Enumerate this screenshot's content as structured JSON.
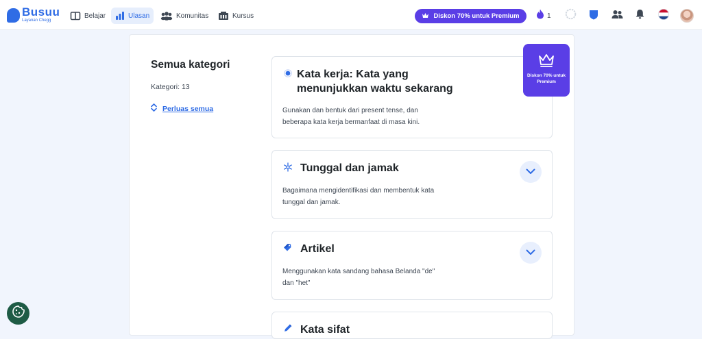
{
  "brand": {
    "name": "Busuu",
    "tagline": "Layanan Chegg"
  },
  "nav": [
    {
      "label": "Belajar",
      "icon": "book-icon",
      "active": false
    },
    {
      "label": "Ulasan",
      "icon": "bar-chart-icon",
      "active": true
    },
    {
      "label": "Komunitas",
      "icon": "community-icon",
      "active": false
    },
    {
      "label": "Kursus",
      "icon": "courses-icon",
      "active": false
    }
  ],
  "promo": {
    "label": "Diskon 70% untuk Premium",
    "color": "#5a3ee6"
  },
  "status": {
    "streak": "1"
  },
  "sidebar": {
    "title": "Semua kategori",
    "count": "Kategori: 13",
    "expand_label": "Perluas semua"
  },
  "categories": [
    {
      "title_line1": "Kata kerja: Kata yang",
      "title_line2": "menunjukkan waktu sekarang",
      "desc_line1": "Gunakan dan bentuk dari present tense, dan",
      "desc_line2": "beberapa kata kerja bermanfaat di masa kini.",
      "icon": "radio-dot-icon"
    },
    {
      "title": "Tunggal dan jamak",
      "desc_line1": "Bagaimana mengidentifikasi dan membentuk kata",
      "desc_line2": "tunggal dan jamak.",
      "icon": "snowflake-icon"
    },
    {
      "title": "Artikel",
      "desc_line1": "Menggunakan kata sandang bahasa Belanda \"de\"",
      "desc_line2": "dan \"het\"",
      "icon": "tag-icon"
    },
    {
      "title": "Kata sifat",
      "icon": "pencil-icon"
    }
  ],
  "badge": {
    "label": "Diskon 70% untuk Premium"
  },
  "colors": {
    "accent": "#2f6ce5",
    "premium": "#5a3ee6",
    "background": "#f1f5fd",
    "cookie": "#1e5b45"
  }
}
